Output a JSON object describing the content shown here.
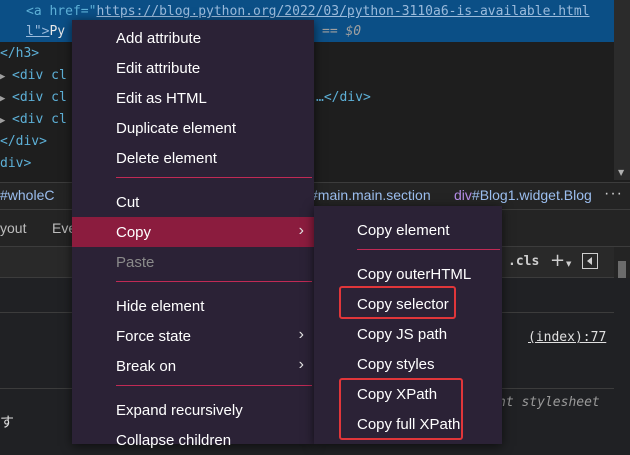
{
  "code": {
    "line1_indent": "    ",
    "line1_tag_open": "<a href=\"",
    "line1_href": "https://blog.python.org/2022/03/python-3110a6-is-available.html",
    "line2_prefix": "l\">",
    "line2_text": "Py",
    "line2_eq": "== $0",
    "line3": "  </h3>",
    "line4": "<div cl",
    "line5": "<div cl",
    "line5_tail": "…</div>",
    "line6": "<div cl",
    "line7": "</div>",
    "line8": "div>"
  },
  "breadcrumb": {
    "first": "#wholeC",
    "second_tag": "",
    "second_rest": "#main.main.section",
    "third_tag": "div",
    "third_rest": "#Blog1.widget.Blog",
    "more": "···"
  },
  "tabs": {
    "layout": "yout",
    "event": "Eve"
  },
  "styles": {
    "cls": ".cls",
    "plus": "+",
    "index_link": "(index):77",
    "ua_note": "nt stylesheet",
    "jp": "す"
  },
  "menu": {
    "items": [
      {
        "label": "Add attribute"
      },
      {
        "label": "Edit attribute"
      },
      {
        "label": "Edit as HTML"
      },
      {
        "label": "Duplicate element"
      },
      {
        "label": "Delete element"
      },
      {
        "label": "Cut"
      },
      {
        "label": "Copy"
      },
      {
        "label": "Paste"
      },
      {
        "label": "Hide element"
      },
      {
        "label": "Force state"
      },
      {
        "label": "Break on"
      },
      {
        "label": "Expand recursively"
      },
      {
        "label": "Collapse children"
      }
    ],
    "submenu_glyph": "›"
  },
  "submenu": {
    "items": [
      {
        "label": "Copy element"
      },
      {
        "label": "Copy outerHTML"
      },
      {
        "label": "Copy selector"
      },
      {
        "label": "Copy JS path"
      },
      {
        "label": "Copy styles"
      },
      {
        "label": "Copy XPath"
      },
      {
        "label": "Copy full XPath"
      }
    ]
  },
  "colors": {
    "menu_bg": "#2b2236",
    "menu_active": "#8b1c3e",
    "separator": "#c02a55",
    "highlight_box": "#e0363a"
  }
}
